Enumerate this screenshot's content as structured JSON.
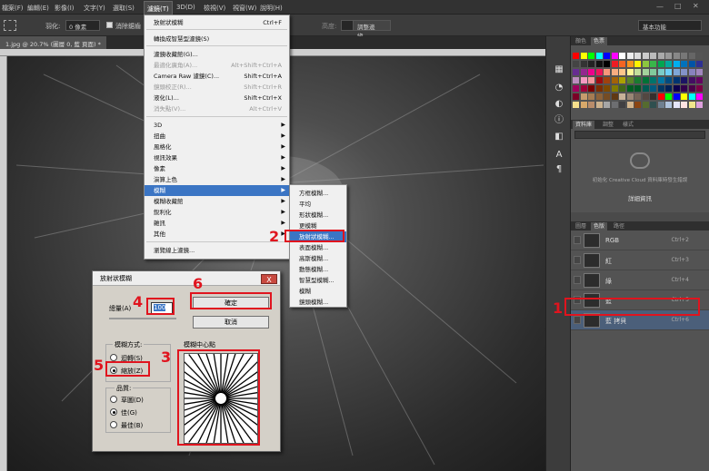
{
  "menubar": {
    "items": [
      "檔案(F)",
      "編輯(E)",
      "影像(I)",
      "文字(Y)",
      "選取(S)",
      "濾鏡(T)",
      "3D(D)",
      "檢視(V)",
      "視窗(W)",
      "說明(H)"
    ],
    "active_index": 5
  },
  "optbar": {
    "feather_label": "羽化:",
    "feather_value": "0 像素",
    "antialias_label": "消除鋸齒",
    "height_label": "高度:",
    "refine_edge": "調整邊緣...",
    "workspace": "基本功能"
  },
  "document": {
    "tab_name": "1.jpg @ 20.7% (圖層 0, 藍 頁面) *"
  },
  "filter_menu": {
    "items": [
      {
        "label": "放射狀模糊",
        "shortcut": "Ctrl+F",
        "disabled": false
      },
      {
        "label": "轉換成智慧型濾鏡(S)",
        "shortcut": "",
        "disabled": false
      },
      {
        "label": "濾鏡收藏館(G)...",
        "shortcut": "",
        "disabled": false
      },
      {
        "label": "最適化廣角(A)...",
        "shortcut": "Alt+Shift+Ctrl+A",
        "disabled": true
      },
      {
        "label": "Camera Raw 濾鏡(C)...",
        "shortcut": "Shift+Ctrl+A",
        "disabled": false
      },
      {
        "label": "鏡頭校正(R)...",
        "shortcut": "Shift+Ctrl+R",
        "disabled": true
      },
      {
        "label": "液化(L)...",
        "shortcut": "Shift+Ctrl+X",
        "disabled": false
      },
      {
        "label": "消失點(V)...",
        "shortcut": "Alt+Ctrl+V",
        "disabled": true
      },
      {
        "label": "3D",
        "shortcut": "",
        "disabled": false
      },
      {
        "label": "扭曲",
        "shortcut": "",
        "disabled": false
      },
      {
        "label": "風格化",
        "shortcut": "",
        "disabled": false
      },
      {
        "label": "視訊效果",
        "shortcut": "",
        "disabled": false
      },
      {
        "label": "像素",
        "shortcut": "",
        "disabled": false
      },
      {
        "label": "演算上色",
        "shortcut": "",
        "disabled": false
      },
      {
        "label": "模糊",
        "shortcut": "",
        "disabled": false
      },
      {
        "label": "模糊收藏館",
        "shortcut": "",
        "disabled": false
      },
      {
        "label": "銳利化",
        "shortcut": "",
        "disabled": false
      },
      {
        "label": "雜訊",
        "shortcut": "",
        "disabled": false
      },
      {
        "label": "其他",
        "shortcut": "",
        "disabled": false
      },
      {
        "label": "瀏覽線上濾鏡...",
        "shortcut": "",
        "disabled": false
      }
    ]
  },
  "blur_submenu": {
    "items": [
      "方框模糊...",
      "平均",
      "形狀模糊...",
      "更模糊",
      "放射狀模糊...",
      "表面模糊...",
      "高斯模糊...",
      "動態模糊...",
      "智慧型模糊...",
      "模糊",
      "鏡頭模糊..."
    ],
    "active_index": 4
  },
  "dialog": {
    "title": "放射狀模糊",
    "close_glyph": "X",
    "amount_label": "總量(A)",
    "amount_value": "100",
    "ok_label": "確定",
    "cancel_label": "取消",
    "method_label": "模糊方式:",
    "method_spin": "迴轉(S)",
    "method_zoom": "縮放(Z)",
    "method_selected": "zoom",
    "quality_label": "品質:",
    "quality_draft": "草圖(D)",
    "quality_good": "佳(G)",
    "quality_best": "最佳(B)",
    "quality_selected": "good",
    "center_label": "模糊中心點"
  },
  "right_panel": {
    "swatch_tabs": [
      "顏色",
      "色票"
    ],
    "adjust_tabs": [
      "資料庫",
      "調整",
      "樣式"
    ],
    "cc_text": "初始化 Creative Cloud 資料庫時發生錯誤",
    "cc_link": "詳細資訊",
    "layer_tabs": [
      "圖層",
      "色版",
      "路徑"
    ],
    "channels": [
      {
        "name": "RGB",
        "shortcut": "Ctrl+2"
      },
      {
        "name": "紅",
        "shortcut": "Ctrl+3"
      },
      {
        "name": "綠",
        "shortcut": "Ctrl+4"
      },
      {
        "name": "藍",
        "shortcut": "Ctrl+5"
      },
      {
        "name": "藍 拷貝",
        "shortcut": "Ctrl+6"
      }
    ],
    "selected_channel": 4
  },
  "annotations": [
    "1",
    "2",
    "3",
    "4",
    "5",
    "6"
  ],
  "colors": {
    "annotation_red": "#e0141e",
    "highlight_blue": "#3b75c4",
    "selected_layer": "#4b5f7a"
  }
}
